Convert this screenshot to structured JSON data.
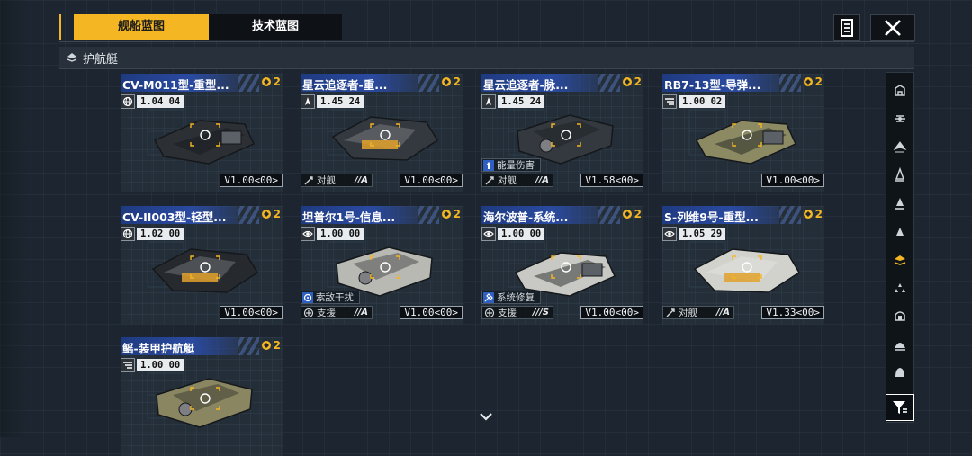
{
  "tabs": [
    {
      "label": "舰船蓝图",
      "active": true
    },
    {
      "label": "技术蓝图",
      "active": false
    }
  ],
  "header": {
    "doc_icon": "document-icon",
    "close_icon": "close-icon"
  },
  "section": {
    "title": "护航艇"
  },
  "colors": {
    "accent": "#f4b623",
    "name_bar": "#2a4aa0",
    "background": "#1d2630"
  },
  "cards": [
    {
      "name": "CV-M011型-重型...",
      "count": "2",
      "stat_icon": "globe-icon",
      "stat": "1.04  04",
      "skills": [],
      "role": "",
      "grade": "",
      "version": "V1.00<00>",
      "ship_color": "#2c2f34"
    },
    {
      "name": "星云追逐者-重...",
      "count": "2",
      "stat_icon": "fin-icon",
      "stat": "1.45  24",
      "skills": [],
      "role": "对舰",
      "grade": "//A",
      "version": "V1.00<00>",
      "ship_color": "#34393f"
    },
    {
      "name": "星云追逐者-脉...",
      "count": "2",
      "stat_icon": "fin-icon",
      "stat": "1.45  24",
      "skills": [
        {
          "icon": "arrow-up-icon",
          "label": "能量伤害"
        }
      ],
      "role": "对舰",
      "grade": "//A",
      "version": "V1.58<00>",
      "ship_color": "#34393f"
    },
    {
      "name": "RB7-13型-导弹...",
      "count": "2",
      "stat_icon": "stripe-icon",
      "stat": "1.00  02",
      "skills": [],
      "role": "",
      "grade": "",
      "version": "V1.00<00>",
      "ship_color": "#8c8a63"
    },
    {
      "name": "CV-II003型-轻型...",
      "count": "2",
      "stat_icon": "globe-icon",
      "stat": "1.02  00",
      "skills": [],
      "role": "",
      "grade": "",
      "version": "V1.00<00>",
      "ship_color": "#262a2f"
    },
    {
      "name": "坦普尔1号-信息...",
      "count": "2",
      "stat_icon": "eye-icon",
      "stat": "1.00  00",
      "skills": [
        {
          "icon": "radar-icon",
          "label": "索敌干扰"
        }
      ],
      "role": "支援",
      "grade": "//A",
      "version": "V1.00<00>",
      "ship_color": "#b9b9b4"
    },
    {
      "name": "海尔波普-系统...",
      "count": "2",
      "stat_icon": "eye-icon",
      "stat": "1.00  00",
      "skills": [
        {
          "icon": "repair-icon",
          "label": "系统修复"
        }
      ],
      "role": "支援",
      "grade": "///S",
      "version": "V1.00<00>",
      "ship_color": "#c8c8c4"
    },
    {
      "name": "S-列维9号-重型...",
      "count": "2",
      "stat_icon": "eye-icon",
      "stat": "1.05  29",
      "skills": [],
      "role": "对舰",
      "grade": "//A",
      "version": "V1.33<00>",
      "ship_color": "#d2d2cd"
    },
    {
      "name": "鳐-装甲护航艇",
      "count": "2",
      "stat_icon": "stripe-icon",
      "stat": "1.00  00",
      "skills": [],
      "role": "",
      "grade": "",
      "version": "",
      "ship_color": "#8a8662"
    }
  ],
  "sidebar": {
    "items": [
      "hangar-icon",
      "carrier-icon",
      "cruiser-icon",
      "destroyer-icon",
      "frigate-icon",
      "corvette-icon",
      "escort-icon",
      "fighter-icon",
      "station-icon",
      "dome-icon",
      "bell-icon"
    ],
    "active_index": 6,
    "filter_icon": "filter-icon"
  },
  "scroll_hint": "chevron-down-icon"
}
